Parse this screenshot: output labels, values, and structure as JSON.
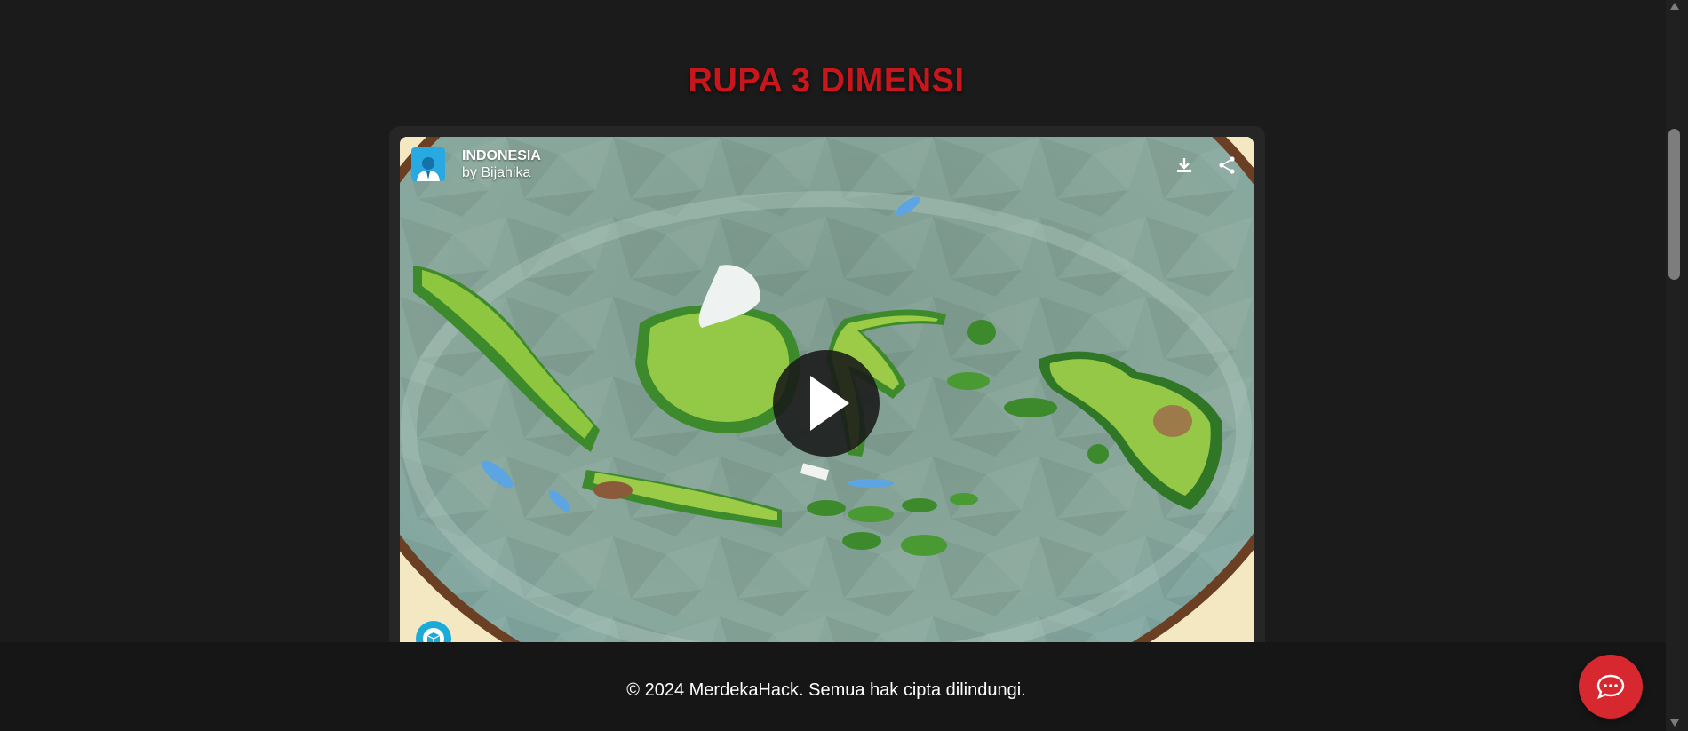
{
  "page": {
    "title": "RUPA 3 DIMENSI",
    "title_color": "#c8161d"
  },
  "viewer": {
    "model_name": "INDONESIA",
    "model_author": "by Bijahika",
    "icons": {
      "avatar": "user-avatar-icon",
      "download": "download-icon",
      "share": "share-icon",
      "play": "play-icon",
      "brand": "sketchfab-logo-icon"
    }
  },
  "footer": {
    "copyright": "© 2024 MerdekaHack. Semua hak cipta dilindungi."
  },
  "chat": {
    "icon": "chat-bubble-icon",
    "color": "#d6282e"
  }
}
